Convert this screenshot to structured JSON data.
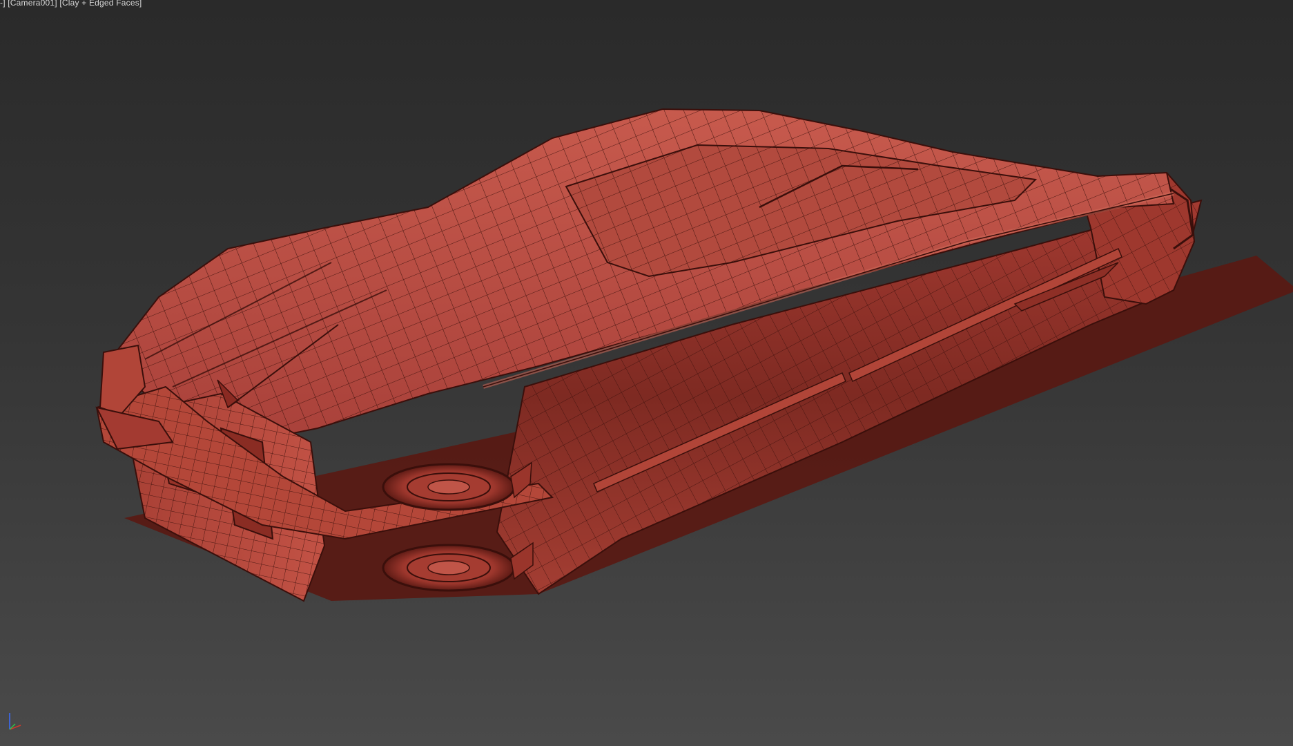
{
  "viewport": {
    "label": "-] [Camera001] [Clay + Edged Faces]",
    "background_top": "#2a2a2a",
    "background_bottom": "#4a4a4a"
  },
  "model": {
    "body_color": "#b8473c",
    "shadow_color": "#6e1f18",
    "highlight_color": "#d06a5c",
    "wire_color": "#3a0f0b"
  },
  "gizmo": {
    "icon": "axis-tripod-icon",
    "x_color": "#d03a2c",
    "y_color": "#2ec24a",
    "z_color": "#3a6cff"
  }
}
